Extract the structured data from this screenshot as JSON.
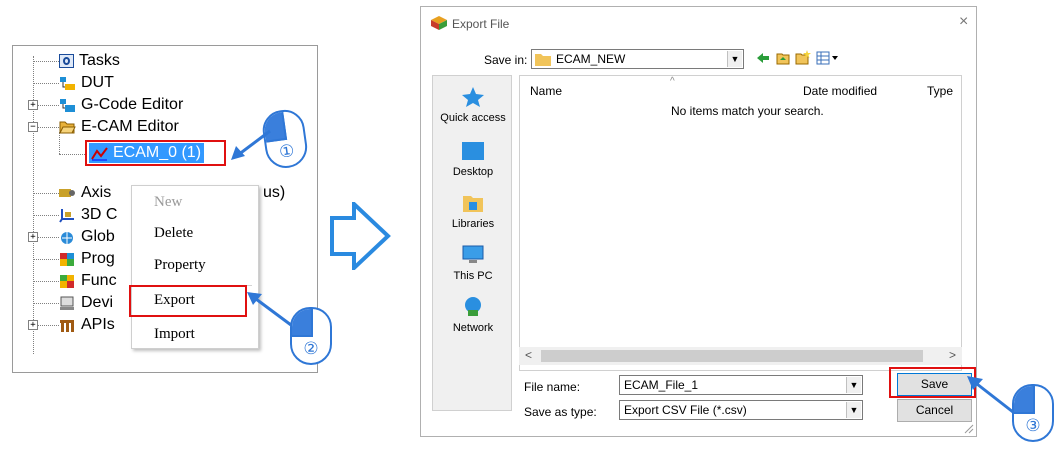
{
  "tree": {
    "items": [
      {
        "label": "Tasks"
      },
      {
        "label": "DUT"
      },
      {
        "label": "G-Code Editor"
      },
      {
        "label": "E-CAM Editor"
      },
      {
        "label": "ECAM_0 (1)"
      },
      {
        "label": "Axis",
        "suffix": "us)"
      },
      {
        "label": "3D C"
      },
      {
        "label": "Glob"
      },
      {
        "label": "Prog"
      },
      {
        "label": "Func"
      },
      {
        "label": "Devi"
      },
      {
        "label": "APIs"
      }
    ],
    "expanders": [
      "+",
      "−",
      "+",
      "+"
    ]
  },
  "context_menu": {
    "items": [
      "New",
      "Delete",
      "Property",
      "Export",
      "Import"
    ]
  },
  "steps": {
    "one": "①",
    "two": "②",
    "three": "③"
  },
  "dialog": {
    "title": "Export File",
    "close": "×",
    "save_in_label": "Save in:",
    "save_in_value": "ECAM_NEW",
    "columns": [
      "Name",
      "Date modified",
      "Type"
    ],
    "sort_arrow": "^",
    "empty_message": "No items match your search.",
    "places": [
      "Quick access",
      "Desktop",
      "Libraries",
      "This PC",
      "Network"
    ],
    "file_name_label": "File name:",
    "file_name_value": "ECAM_File_1",
    "save_type_label": "Save as type:",
    "save_type_value": "Export CSV File (*.csv)",
    "save_button": "Save",
    "cancel_button": "Cancel",
    "scroll_left": "<",
    "scroll_right": ">"
  },
  "colors": {
    "accent": "#2f77d6",
    "highlight": "#e01010",
    "selection": "#3399ff"
  }
}
